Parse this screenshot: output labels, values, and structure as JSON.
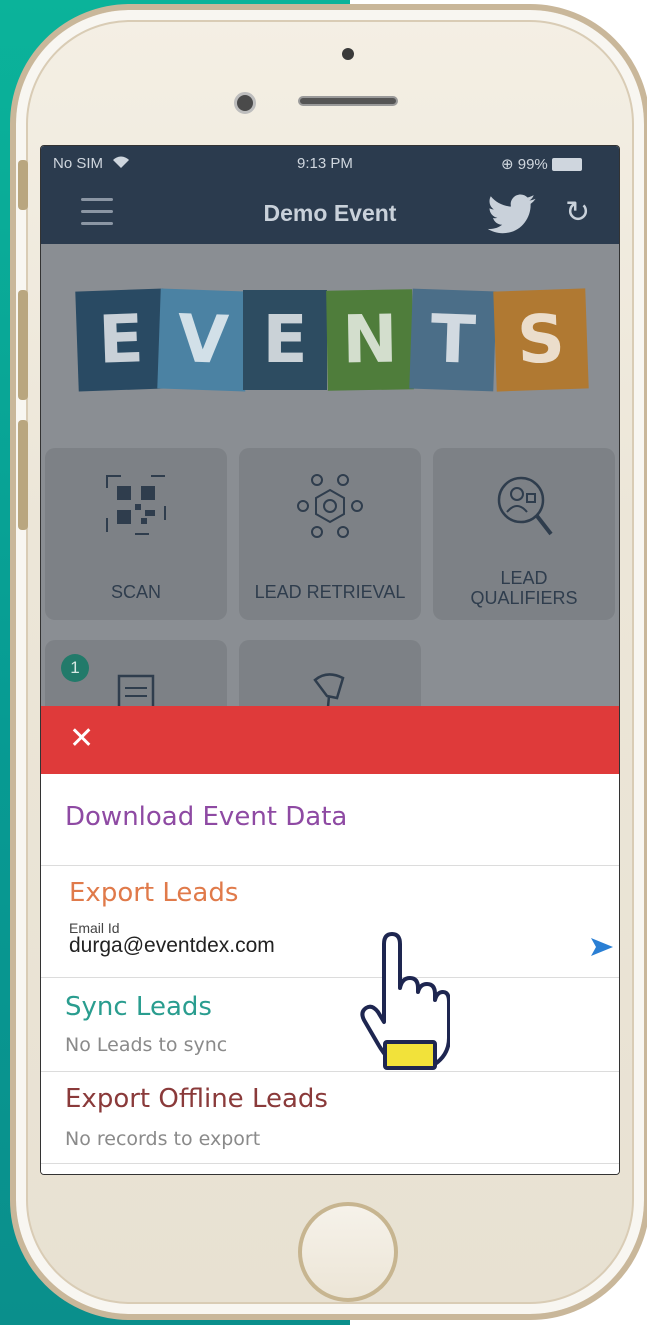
{
  "status_bar": {
    "carrier": "No SIM",
    "time": "9:13 PM",
    "battery": "99%"
  },
  "nav": {
    "title": "Demo Event"
  },
  "logo": {
    "letters": [
      "E",
      "V",
      "E",
      "N",
      "T",
      "S"
    ]
  },
  "tiles": [
    {
      "label": "SCAN",
      "icon": "qr-code-icon"
    },
    {
      "label": "LEAD RETRIEVAL",
      "icon": "network-icon"
    },
    {
      "label_line1": "LEAD",
      "label_line2": "QUALIFIERS",
      "icon": "search-person-icon"
    },
    {
      "badge": "1",
      "icon": "document-icon"
    },
    {
      "icon": "barcode-scanner-icon"
    }
  ],
  "sheet": {
    "download": {
      "title": "Download Event Data"
    },
    "export": {
      "title": "Export Leads",
      "email_label": "Email Id",
      "email_value": "durga@eventdex.com"
    },
    "sync": {
      "title": "Sync Leads",
      "subtitle": "No Leads to sync"
    },
    "offline": {
      "title": "Export Offline Leads",
      "subtitle": "No records to export"
    }
  },
  "colors": {
    "nav_bg": "#2b3b4e",
    "sheet_header": "#df3a3a",
    "download_title": "#8e4aa3",
    "export_title": "#e07a4a",
    "sync_title": "#2a9d8f",
    "offline_title": "#8a3a3a",
    "send_icon": "#2a7fd4"
  }
}
